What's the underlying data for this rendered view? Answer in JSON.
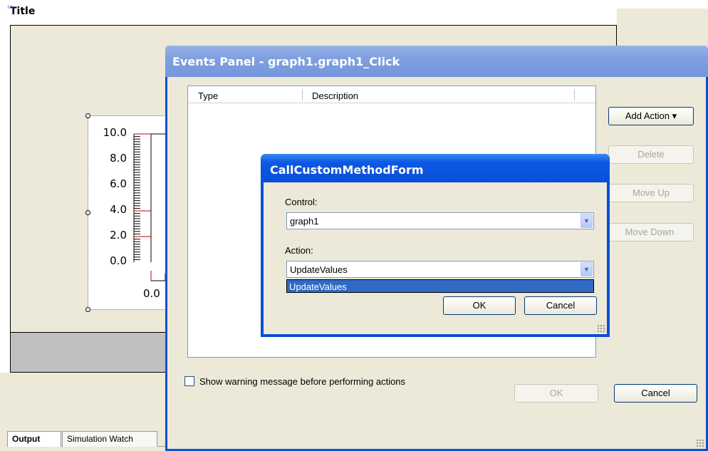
{
  "designer": {
    "title": "Title",
    "graph": {
      "y_ticks": [
        "10.0",
        "8.0",
        "6.0",
        "4.0",
        "2.0",
        "0.0"
      ],
      "x_tick": "0.0"
    },
    "tabs": [
      "Output",
      "Simulation Watch"
    ]
  },
  "events_panel": {
    "title": "Events Panel - graph1.graph1_Click",
    "columns": [
      "Type",
      "Description"
    ],
    "buttons": {
      "add_action": "Add Action ▾",
      "delete": "Delete",
      "move_up": "Move Up",
      "move_down": "Move Down",
      "ok": "OK",
      "cancel": "Cancel"
    },
    "warning_checkbox": "Show warning message before performing actions"
  },
  "custom_form": {
    "title": "CallCustomMethodForm",
    "control_label": "Control:",
    "control_value": "graph1",
    "action_label": "Action:",
    "action_value": "UpdateValues",
    "action_options": [
      "UpdateValues"
    ],
    "ok": "OK",
    "cancel": "Cancel"
  },
  "colors": {
    "panel_title": "#7f9fe0",
    "dialog_title": "#0a4fd8",
    "selection": "#316ac5",
    "face": "#ece9d8"
  },
  "icons": [
    "dropdown-arrow-icon",
    "resize-grip-icon"
  ]
}
